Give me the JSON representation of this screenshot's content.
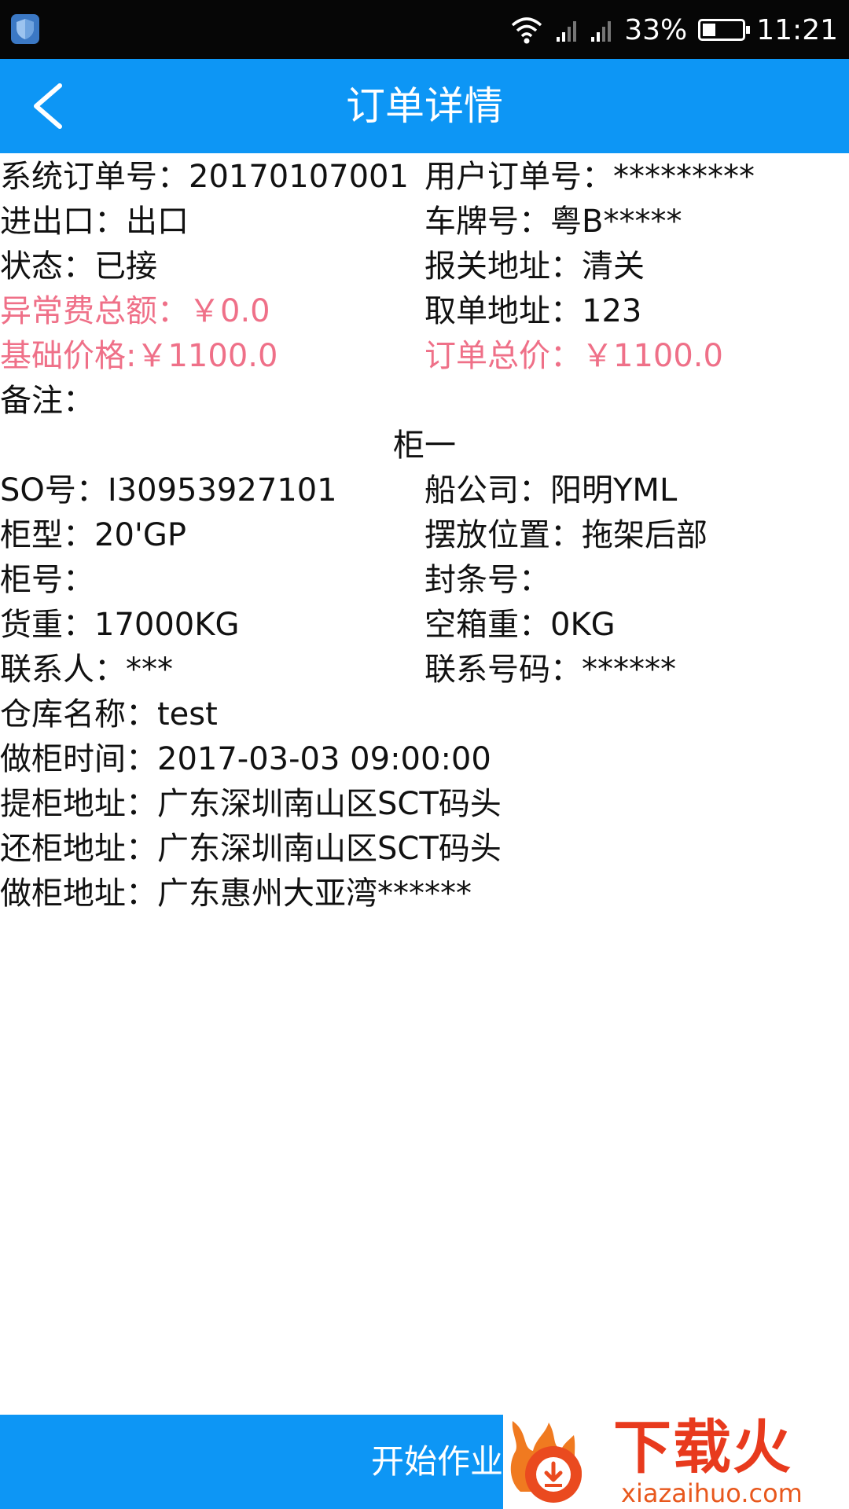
{
  "status_bar": {
    "battery": "33%",
    "battery_level": 0.33,
    "time": "11:21"
  },
  "header": {
    "title": "订单详情"
  },
  "order": {
    "system_order_no": "系统订单号：20170107001",
    "user_order_no": "用户订单号：*********",
    "import_export": "进出口：出口",
    "plate_no": "车牌号：粤B*****",
    "status": "状态：已接",
    "customs_address": "报关地址：清关",
    "abnormal_fee_total": "异常费总额：￥0.0",
    "pickup_doc_address": "取单地址：123",
    "base_price": "基础价格:￥1100.0",
    "order_total": "订单总价：￥1100.0",
    "remark": "备注："
  },
  "container": {
    "title": "柜一",
    "so_no": "SO号：I30953927101",
    "shipping_company": "船公司：阳明YML",
    "container_type": "柜型：20'GP",
    "placement": "摆放位置：拖架后部",
    "container_no": "柜号：",
    "seal_no": "封条号：",
    "cargo_weight": "货重：17000KG",
    "empty_weight": "空箱重：0KG",
    "contact": "联系人：***",
    "contact_phone": "联系号码：******",
    "warehouse": "仓库名称：test",
    "loading_time": "做柜时间：2017-03-03 09:00:00",
    "pickup_address": "提柜地址：广东深圳南山区SCT码头",
    "return_address": "还柜地址：广东深圳南山区SCT码头",
    "loading_address": "做柜地址：广东惠州大亚湾******"
  },
  "footer": {
    "start_button": "开始作业"
  },
  "watermark": {
    "text": "下载火",
    "url": "xiazaihuo.com"
  },
  "colors": {
    "primary": "#0d96f5",
    "highlight": "#ef7088",
    "status_bar": "#060606"
  }
}
